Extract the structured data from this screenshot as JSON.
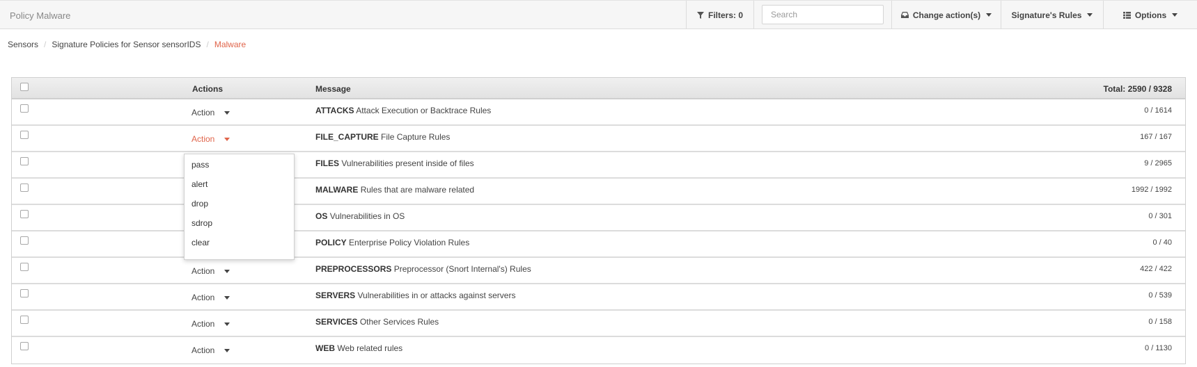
{
  "header": {
    "title": "Policy Malware",
    "filters_label": "Filters: 0",
    "search_placeholder": "Search",
    "change_actions_label": "Change action(s)",
    "signature_rules_label": "Signature's Rules",
    "options_label": "Options"
  },
  "breadcrumb": {
    "items": [
      "Sensors",
      "Signature Policies for Sensor sensorIDS"
    ],
    "active": "Malware"
  },
  "table": {
    "col_actions": "Actions",
    "col_message": "Message",
    "total": "Total: 2590 / 9328",
    "rows": [
      {
        "action": "Action",
        "name": "ATTACKS",
        "desc": "Attack Execution or Backtrace Rules",
        "count": "0 / 1614"
      },
      {
        "action": "Action",
        "name": "FILE_CAPTURE",
        "desc": "File Capture Rules",
        "count": "167 / 167"
      },
      {
        "action": "Action",
        "name": "FILES",
        "desc": "Vulnerabilities present inside of files",
        "count": "9 / 2965"
      },
      {
        "action": "Action",
        "name": "MALWARE",
        "desc": "Rules that are malware related",
        "count": "1992 / 1992"
      },
      {
        "action": "Action",
        "name": "OS",
        "desc": "Vulnerabilities in OS",
        "count": "0 / 301"
      },
      {
        "action": "Action",
        "name": "POLICY",
        "desc": "Enterprise Policy Violation Rules",
        "count": "0 / 40"
      },
      {
        "action": "Action",
        "name": "PREPROCESSORS",
        "desc": "Preprocessor (Snort Internal's) Rules",
        "count": "422 / 422"
      },
      {
        "action": "Action",
        "name": "SERVERS",
        "desc": "Vulnerabilities in or attacks against servers",
        "count": "0 / 539"
      },
      {
        "action": "Action",
        "name": "SERVICES",
        "desc": "Other Services Rules",
        "count": "0 / 158"
      },
      {
        "action": "Action",
        "name": "WEB",
        "desc": "Web related rules",
        "count": "0 / 1130"
      }
    ]
  },
  "dropdown": {
    "options": [
      "pass",
      "alert",
      "drop",
      "sdrop",
      "clear"
    ]
  },
  "colors": {
    "accent": "#e0644a"
  }
}
